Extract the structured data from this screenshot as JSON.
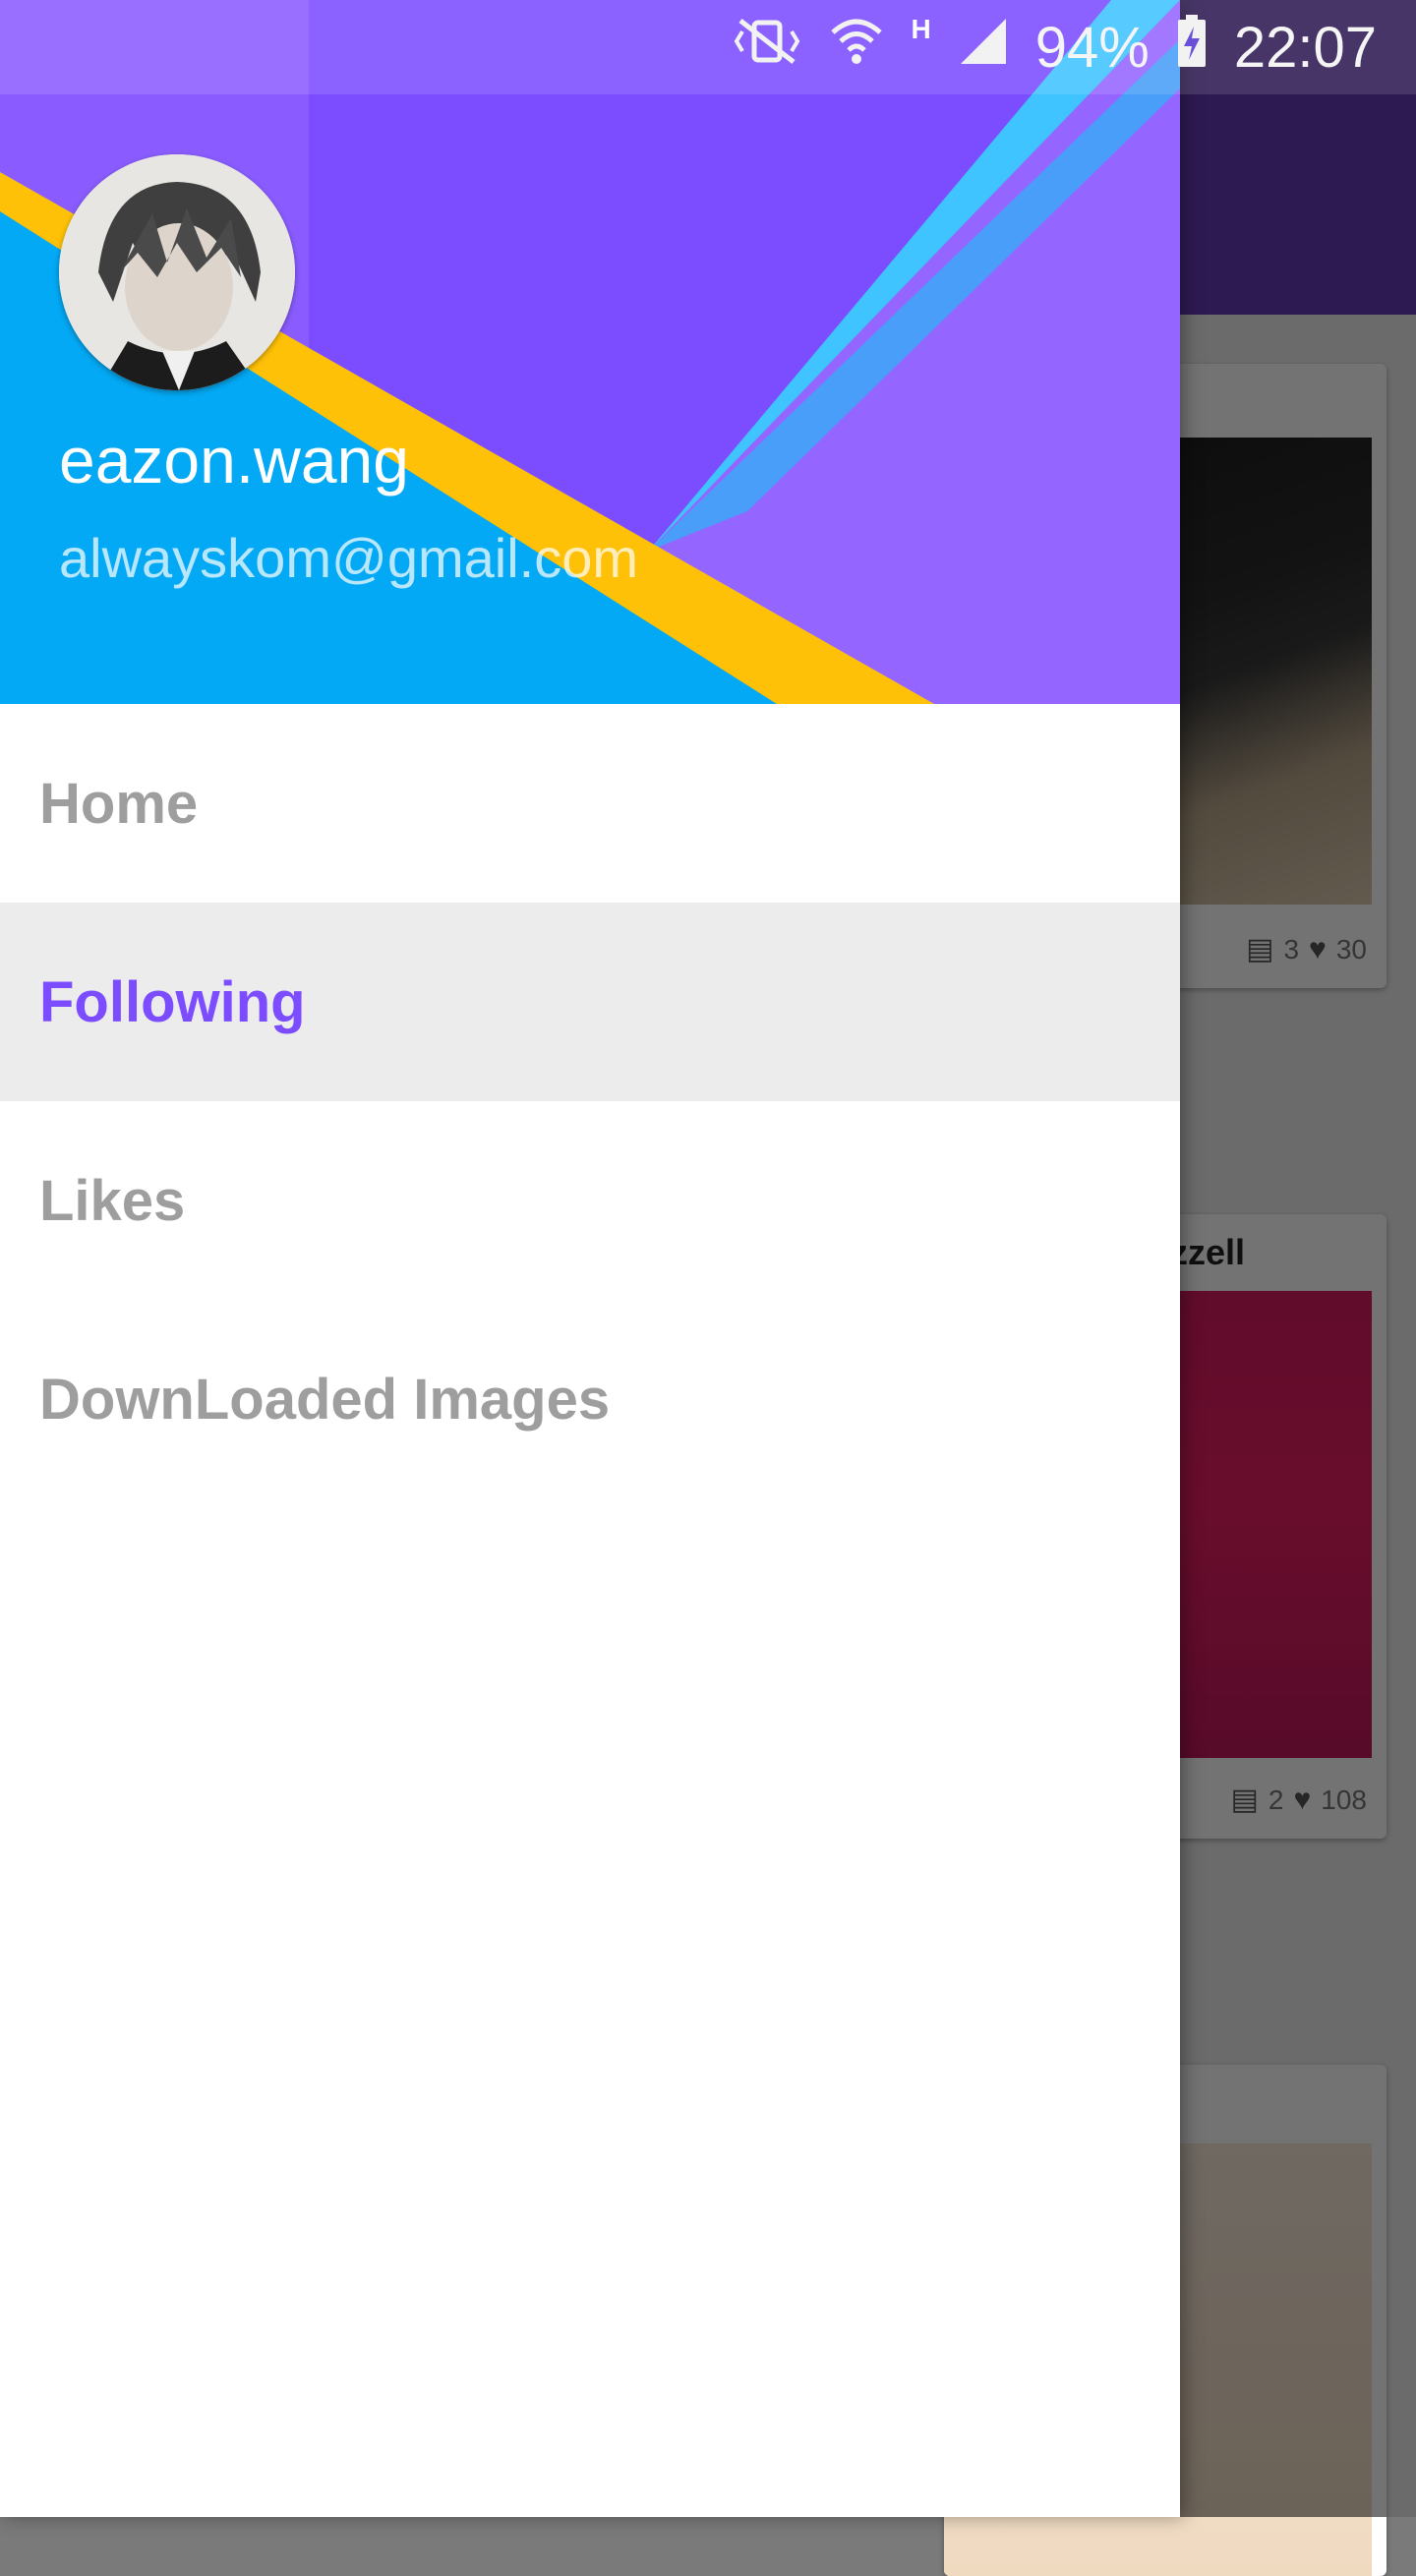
{
  "status_bar": {
    "network_type": "H",
    "battery_percent": "94%",
    "time": "22:07",
    "icons": [
      "vibrate-mute-icon",
      "wifi-icon",
      "signal-icon",
      "battery-charging-icon"
    ]
  },
  "background_feed": {
    "cards": [
      {
        "author": "",
        "comments": "3",
        "likes": "30"
      },
      {
        "author": "ezzell",
        "comments": "2",
        "likes": "108"
      },
      {
        "author": "",
        "comments": "",
        "likes": ""
      }
    ]
  },
  "drawer": {
    "header": {
      "user_name": "eazon.wang",
      "email": "alwayskom@gmail.com"
    },
    "menu": [
      {
        "label": "Home",
        "active": false
      },
      {
        "label": "Following",
        "active": true
      },
      {
        "label": "Likes",
        "active": false
      },
      {
        "label": "DownLoaded Images",
        "active": false
      }
    ]
  },
  "colors": {
    "accent": "#7c4dff",
    "header_blue": "#03a9f4",
    "header_purple": "#7c4dff",
    "header_yellow": "#ffc107",
    "toolbar": "#673ab7"
  }
}
